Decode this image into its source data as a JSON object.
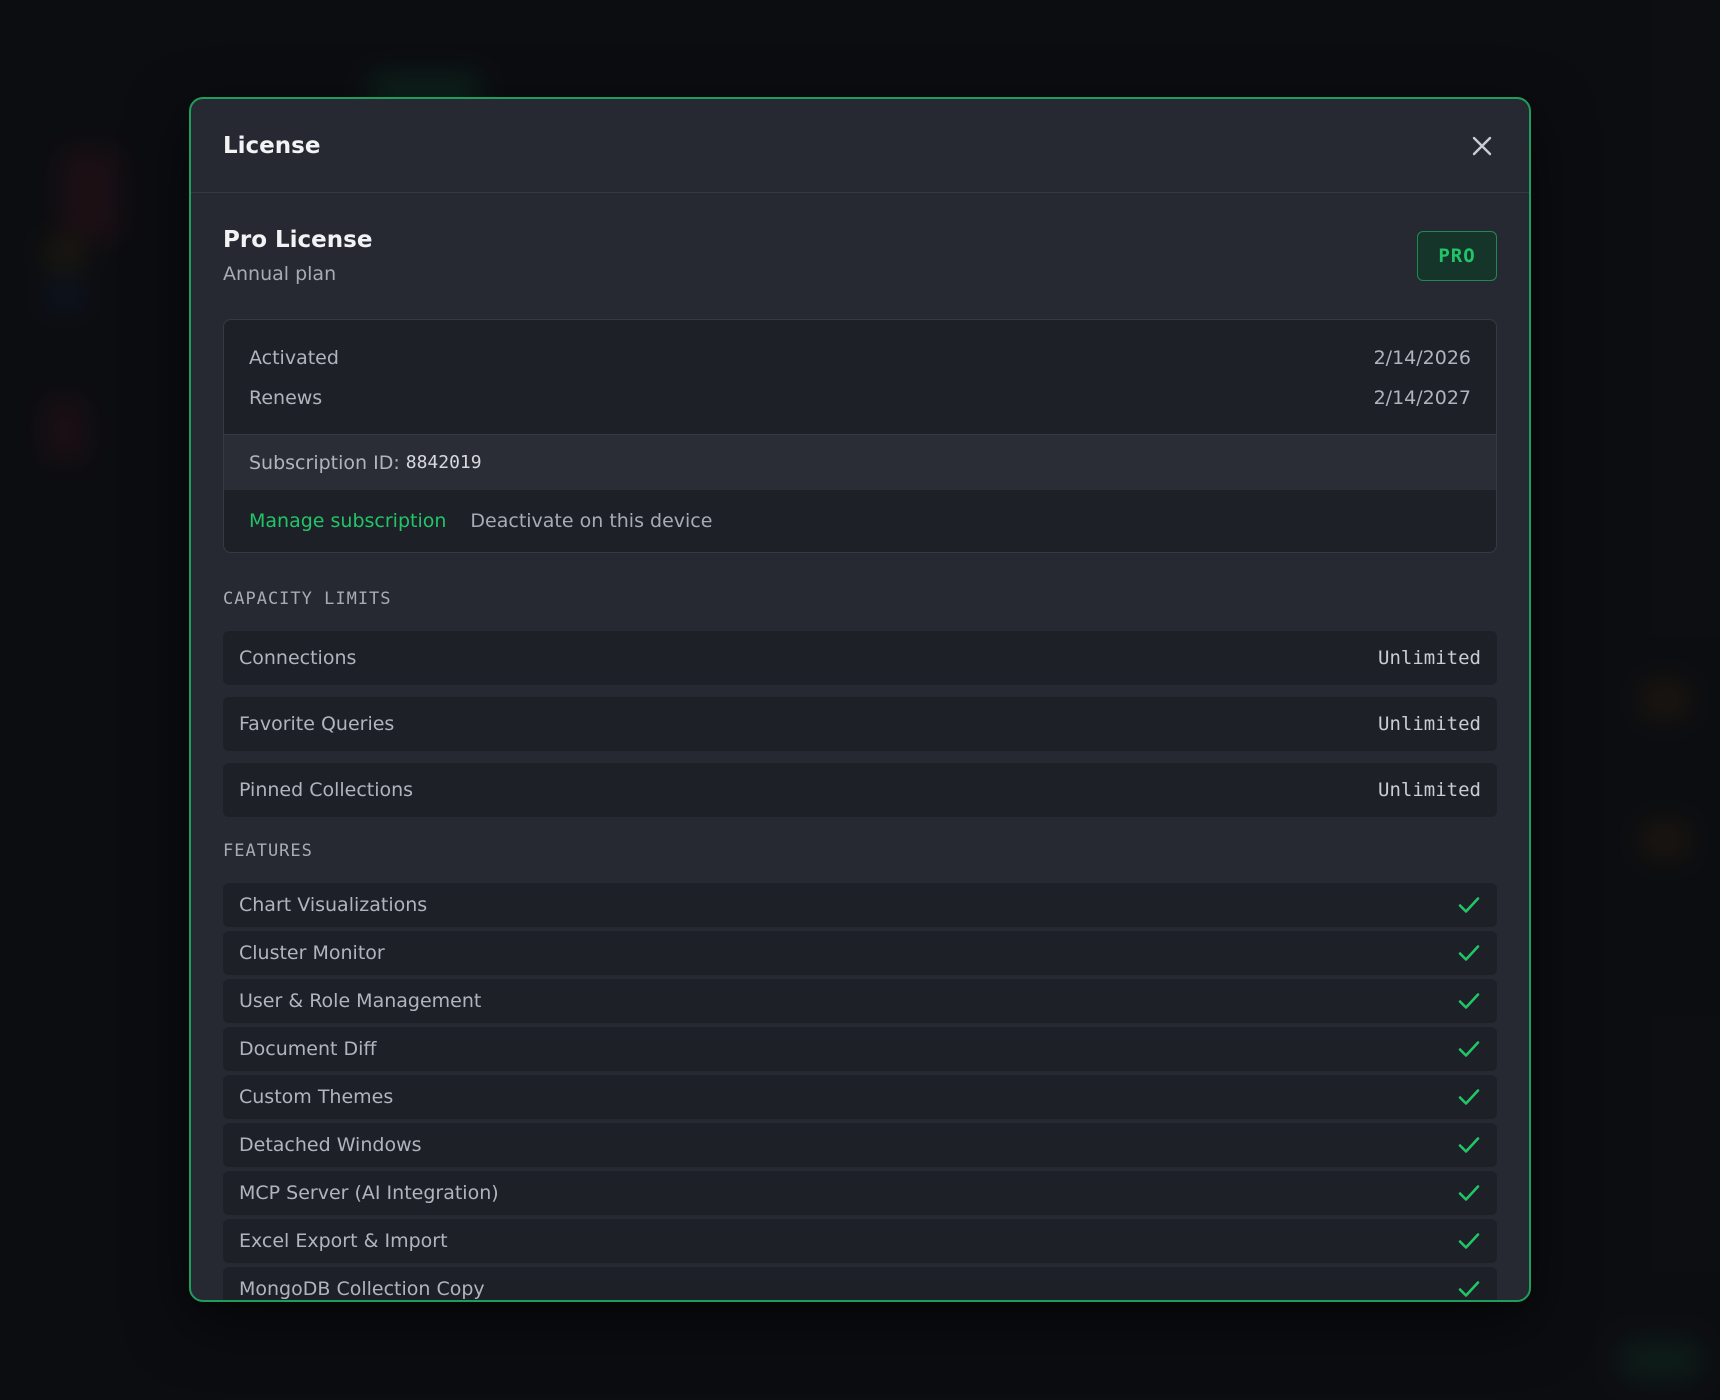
{
  "dialog": {
    "title": "License",
    "close_icon": "close-icon"
  },
  "plan": {
    "name": "Pro License",
    "cycle": "Annual plan",
    "badge": "PRO"
  },
  "details": {
    "activated_label": "Activated",
    "activated_value": "2/14/2026",
    "renews_label": "Renews",
    "renews_value": "2/14/2027",
    "subscription_label": "Subscription ID:",
    "subscription_id": "8842019",
    "manage_link": "Manage subscription",
    "deactivate_link": "Deactivate on this device"
  },
  "capacity": {
    "heading": "CAPACITY LIMITS",
    "rows": [
      {
        "label": "Connections",
        "value": "Unlimited"
      },
      {
        "label": "Favorite Queries",
        "value": "Unlimited"
      },
      {
        "label": "Pinned Collections",
        "value": "Unlimited"
      }
    ]
  },
  "features": {
    "heading": "FEATURES",
    "rows": [
      {
        "label": "Chart Visualizations",
        "icon": "check-icon"
      },
      {
        "label": "Cluster Monitor",
        "icon": "check-icon"
      },
      {
        "label": "User & Role Management",
        "icon": "check-icon"
      },
      {
        "label": "Document Diff",
        "icon": "check-icon"
      },
      {
        "label": "Custom Themes",
        "icon": "check-icon"
      },
      {
        "label": "Detached Windows",
        "icon": "check-icon"
      },
      {
        "label": "MCP Server (AI Integration)",
        "icon": "check-icon"
      },
      {
        "label": "Excel Export & Import",
        "icon": "check-icon"
      },
      {
        "label": "MongoDB Collection Copy",
        "icon": "check-icon"
      }
    ]
  },
  "colors": {
    "accent": "#22c468",
    "border_accent": "#1f9d5a",
    "dialog_bg": "#262932",
    "row_bg": "#1e2027"
  }
}
